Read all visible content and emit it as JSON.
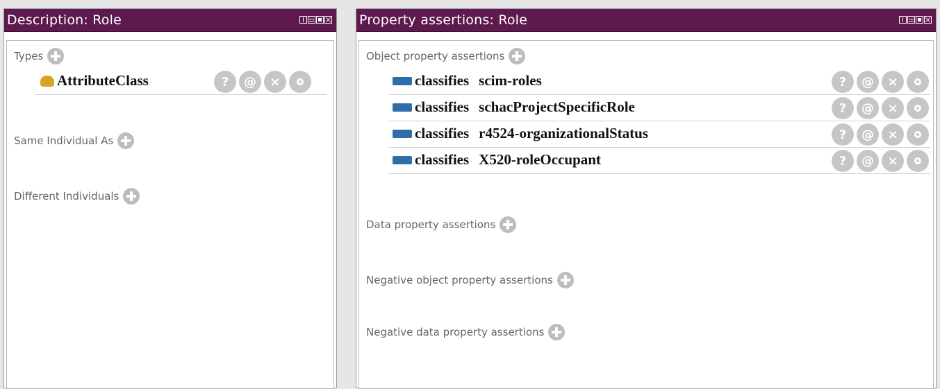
{
  "description_panel": {
    "title": "Description: Role",
    "sections": {
      "types": "Types",
      "same_individual": "Same Individual As",
      "different_individuals": "Different Individuals"
    },
    "types": [
      {
        "label": "AttributeClass"
      }
    ]
  },
  "assertions_panel": {
    "title": "Property assertions: Role",
    "sections": {
      "object": "Object property assertions",
      "data": "Data property assertions",
      "neg_object": "Negative object property assertions",
      "neg_data": "Negative data property assertions"
    },
    "object_assertions": [
      {
        "property": "classifies",
        "value": "scim-roles"
      },
      {
        "property": "classifies",
        "value": "schacProjectSpecificRole"
      },
      {
        "property": "classifies",
        "value": "r4524-organizationalStatus"
      },
      {
        "property": "classifies",
        "value": "X520-roleOccupant"
      }
    ]
  },
  "action_glyphs": {
    "explain": "?",
    "annotate": "@",
    "delete": "×"
  },
  "colors": {
    "titlebar": "#5e1a4e",
    "class_icon": "#d9a426",
    "property_icon": "#2f6ea8",
    "action_button": "#c6c6c6"
  }
}
